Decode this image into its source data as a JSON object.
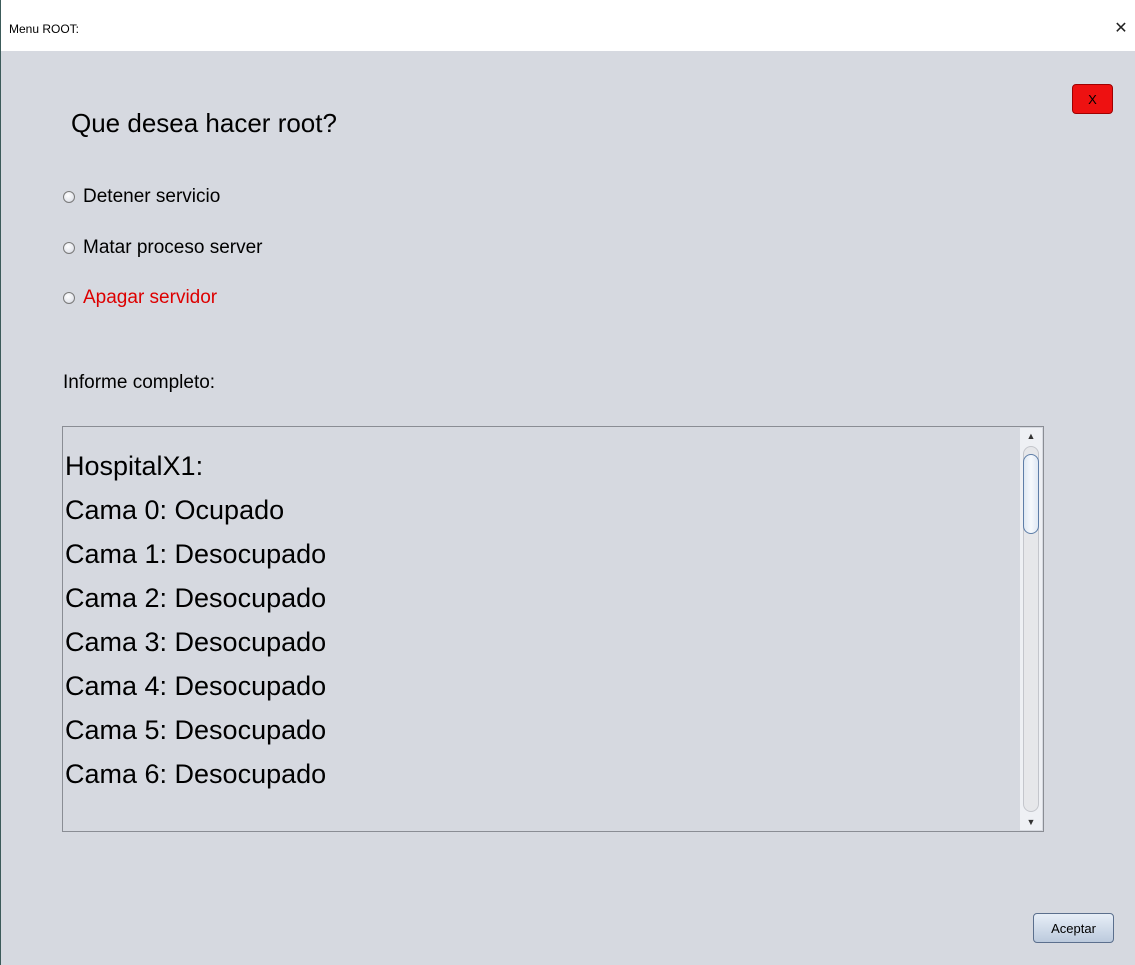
{
  "window": {
    "title": "Menu ROOT:",
    "close_glyph": "✕"
  },
  "close_button": {
    "label": "X",
    "color": "#ee1111"
  },
  "heading": "Que desea hacer root?",
  "options": [
    {
      "label": "Detener servicio",
      "color": "#000000"
    },
    {
      "label": "Matar proceso server",
      "color": "#000000"
    },
    {
      "label": "Apagar servidor",
      "color": "#dd0000"
    }
  ],
  "report": {
    "label": "Informe completo:",
    "lines": [
      "",
      "HospitalX1:",
      "Cama 0: Ocupado",
      "Cama 1: Desocupado",
      "Cama 2: Desocupado",
      "Cama 3: Desocupado",
      "Cama 4: Desocupado",
      "Cama 5: Desocupado",
      "Cama 6: Desocupado"
    ]
  },
  "scrollbar": {
    "up_glyph": "▲",
    "down_glyph": "▼"
  },
  "accept_button": {
    "label": "Aceptar"
  }
}
